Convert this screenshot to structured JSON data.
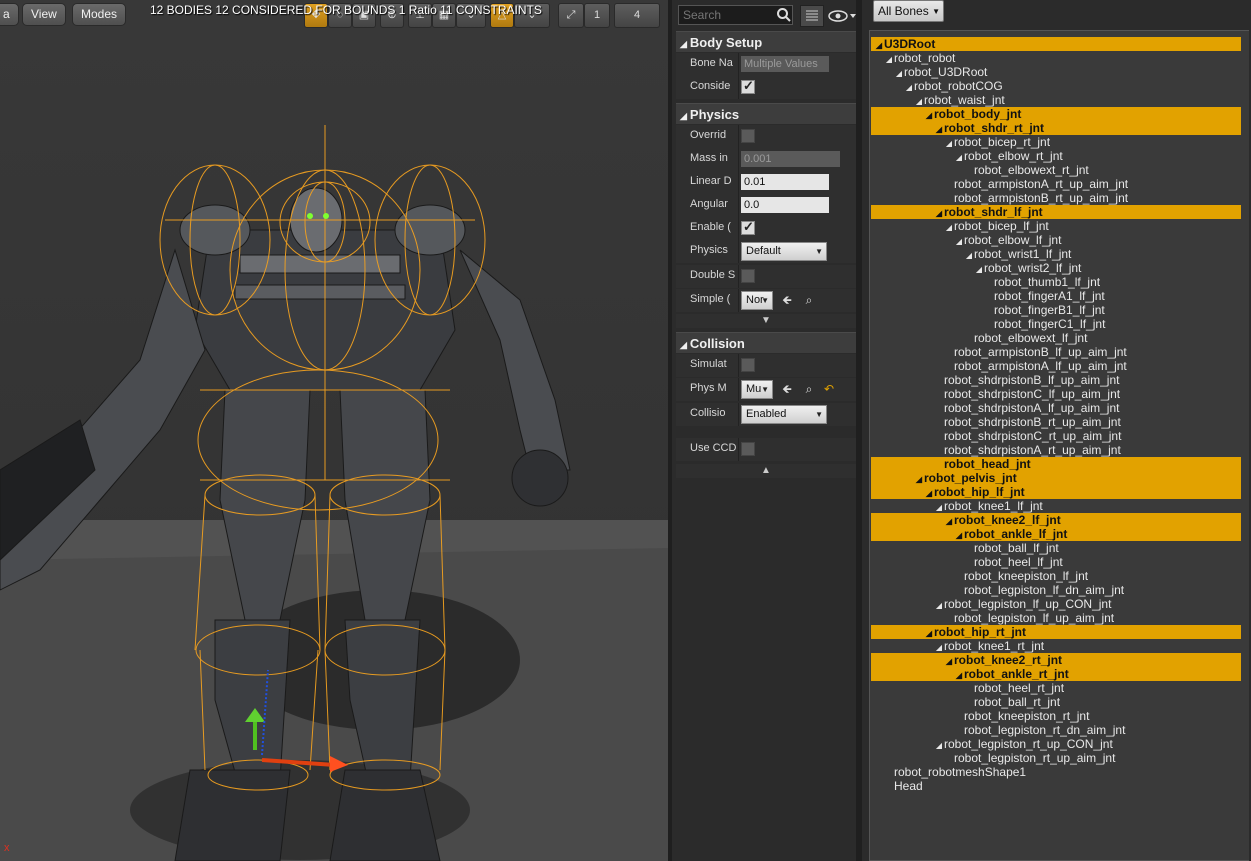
{
  "viewport": {
    "mode_label": "a",
    "view_label": "View",
    "modes_label": "Modes",
    "stats_text": "12 BODIES  12 CONSIDERED  FOR BOUNDS  1 Ratio  11 CONSTRAINTS",
    "toolbar_num_a": "1",
    "toolbar_num_b": "4",
    "axis_label": "x"
  },
  "details": {
    "search_placeholder": "Search",
    "body_setup": {
      "title": "Body Setup",
      "bone_name_label": "Bone Na",
      "bone_name_value": "Multiple Values",
      "consider_label": "Conside"
    },
    "physics": {
      "title": "Physics",
      "override_label": "Overrid",
      "mass_label": "Mass in",
      "mass_value": "0.001",
      "linear_label": "Linear D",
      "linear_value": "0.01",
      "angular_label": "Angular",
      "angular_value": "0.0",
      "enable_label": "Enable (",
      "physics_type_label": "Physics",
      "physics_type_value": "Default",
      "double_label": "Double S",
      "simple_label": "Simple (",
      "simple_value": "Nor"
    },
    "collision": {
      "title": "Collision",
      "simulate_label": "Simulat",
      "phys_mat_label": "Phys M",
      "phys_mat_value": "Mu",
      "collision_label": "Collisio",
      "collision_value": "Enabled",
      "use_ccd_label": "Use CCD"
    }
  },
  "tree": {
    "filter_label": "All Bones",
    "bones": [
      {
        "name": "U3DRoot",
        "depth": 0,
        "sel": true,
        "arrow": true
      },
      {
        "name": "robot_robot",
        "depth": 1,
        "sel": false,
        "arrow": true
      },
      {
        "name": "robot_U3DRoot",
        "depth": 2,
        "sel": false,
        "arrow": true
      },
      {
        "name": "robot_robotCOG",
        "depth": 3,
        "sel": false,
        "arrow": true
      },
      {
        "name": "robot_waist_jnt",
        "depth": 4,
        "sel": false,
        "arrow": true
      },
      {
        "name": "robot_body_jnt",
        "depth": 5,
        "sel": true,
        "arrow": true
      },
      {
        "name": "robot_shdr_rt_jnt",
        "depth": 6,
        "sel": true,
        "arrow": true
      },
      {
        "name": "robot_bicep_rt_jnt",
        "depth": 7,
        "sel": false,
        "arrow": true
      },
      {
        "name": "robot_elbow_rt_jnt",
        "depth": 8,
        "sel": false,
        "arrow": true
      },
      {
        "name": "robot_elbowext_rt_jnt",
        "depth": 9,
        "sel": false,
        "arrow": false
      },
      {
        "name": "robot_armpistonA_rt_up_aim_jnt",
        "depth": 7,
        "sel": false,
        "arrow": false
      },
      {
        "name": "robot_armpistonB_rt_up_aim_jnt",
        "depth": 7,
        "sel": false,
        "arrow": false
      },
      {
        "name": "robot_shdr_lf_jnt",
        "depth": 6,
        "sel": true,
        "arrow": true
      },
      {
        "name": "robot_bicep_lf_jnt",
        "depth": 7,
        "sel": false,
        "arrow": true
      },
      {
        "name": "robot_elbow_lf_jnt",
        "depth": 8,
        "sel": false,
        "arrow": true
      },
      {
        "name": "robot_wrist1_lf_jnt",
        "depth": 9,
        "sel": false,
        "arrow": true
      },
      {
        "name": "robot_wrist2_lf_jnt",
        "depth": 10,
        "sel": false,
        "arrow": true
      },
      {
        "name": "robot_thumb1_lf_jnt",
        "depth": 11,
        "sel": false,
        "arrow": false
      },
      {
        "name": "robot_fingerA1_lf_jnt",
        "depth": 11,
        "sel": false,
        "arrow": false
      },
      {
        "name": "robot_fingerB1_lf_jnt",
        "depth": 11,
        "sel": false,
        "arrow": false
      },
      {
        "name": "robot_fingerC1_lf_jnt",
        "depth": 11,
        "sel": false,
        "arrow": false
      },
      {
        "name": "robot_elbowext_lf_jnt",
        "depth": 9,
        "sel": false,
        "arrow": false
      },
      {
        "name": "robot_armpistonB_lf_up_aim_jnt",
        "depth": 7,
        "sel": false,
        "arrow": false
      },
      {
        "name": "robot_armpistonA_lf_up_aim_jnt",
        "depth": 7,
        "sel": false,
        "arrow": false
      },
      {
        "name": "robot_shdrpistonB_lf_up_aim_jnt",
        "depth": 6,
        "sel": false,
        "arrow": false
      },
      {
        "name": "robot_shdrpistonC_lf_up_aim_jnt",
        "depth": 6,
        "sel": false,
        "arrow": false
      },
      {
        "name": "robot_shdrpistonA_lf_up_aim_jnt",
        "depth": 6,
        "sel": false,
        "arrow": false
      },
      {
        "name": "robot_shdrpistonB_rt_up_aim_jnt",
        "depth": 6,
        "sel": false,
        "arrow": false
      },
      {
        "name": "robot_shdrpistonC_rt_up_aim_jnt",
        "depth": 6,
        "sel": false,
        "arrow": false
      },
      {
        "name": "robot_shdrpistonA_rt_up_aim_jnt",
        "depth": 6,
        "sel": false,
        "arrow": false
      },
      {
        "name": "robot_head_jnt",
        "depth": 6,
        "sel": true,
        "arrow": false
      },
      {
        "name": "robot_pelvis_jnt",
        "depth": 4,
        "sel": true,
        "arrow": true
      },
      {
        "name": "robot_hip_lf_jnt",
        "depth": 5,
        "sel": true,
        "arrow": true
      },
      {
        "name": "robot_knee1_lf_jnt",
        "depth": 6,
        "sel": false,
        "arrow": true
      },
      {
        "name": "robot_knee2_lf_jnt",
        "depth": 7,
        "sel": true,
        "arrow": true
      },
      {
        "name": "robot_ankle_lf_jnt",
        "depth": 8,
        "sel": true,
        "arrow": true
      },
      {
        "name": "robot_ball_lf_jnt",
        "depth": 9,
        "sel": false,
        "arrow": false
      },
      {
        "name": "robot_heel_lf_jnt",
        "depth": 9,
        "sel": false,
        "arrow": false
      },
      {
        "name": "robot_kneepiston_lf_jnt",
        "depth": 8,
        "sel": false,
        "arrow": false
      },
      {
        "name": "robot_legpiston_lf_dn_aim_jnt",
        "depth": 8,
        "sel": false,
        "arrow": false
      },
      {
        "name": "robot_legpiston_lf_up_CON_jnt",
        "depth": 6,
        "sel": false,
        "arrow": true
      },
      {
        "name": "robot_legpiston_lf_up_aim_jnt",
        "depth": 7,
        "sel": false,
        "arrow": false
      },
      {
        "name": "robot_hip_rt_jnt",
        "depth": 5,
        "sel": true,
        "arrow": true
      },
      {
        "name": "robot_knee1_rt_jnt",
        "depth": 6,
        "sel": false,
        "arrow": true
      },
      {
        "name": "robot_knee2_rt_jnt",
        "depth": 7,
        "sel": true,
        "arrow": true
      },
      {
        "name": "robot_ankle_rt_jnt",
        "depth": 8,
        "sel": true,
        "arrow": true
      },
      {
        "name": "robot_heel_rt_jnt",
        "depth": 9,
        "sel": false,
        "arrow": false
      },
      {
        "name": "robot_ball_rt_jnt",
        "depth": 9,
        "sel": false,
        "arrow": false
      },
      {
        "name": "robot_kneepiston_rt_jnt",
        "depth": 8,
        "sel": false,
        "arrow": false
      },
      {
        "name": "robot_legpiston_rt_dn_aim_jnt",
        "depth": 8,
        "sel": false,
        "arrow": false
      },
      {
        "name": "robot_legpiston_rt_up_CON_jnt",
        "depth": 6,
        "sel": false,
        "arrow": true
      },
      {
        "name": "robot_legpiston_rt_up_aim_jnt",
        "depth": 7,
        "sel": false,
        "arrow": false
      },
      {
        "name": "robot_robotmeshShape1",
        "depth": 1,
        "sel": false,
        "arrow": false
      },
      {
        "name": "Head",
        "depth": 1,
        "sel": false,
        "arrow": false
      }
    ]
  },
  "colors": {
    "selection": "#e2a200",
    "wireframe": "#f0a020",
    "panel_bg": "#2b2b2b"
  }
}
